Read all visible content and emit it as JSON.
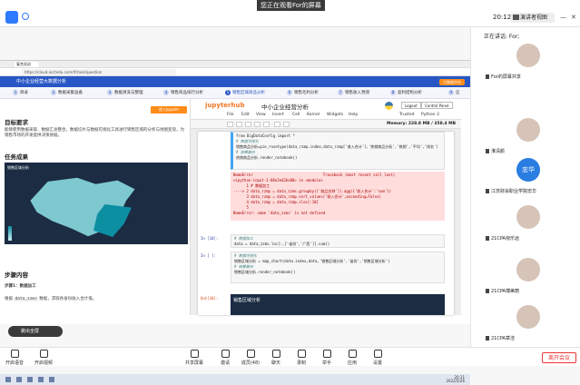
{
  "meeting": {
    "banner": "您正在观看For的屏幕",
    "time": "20:12",
    "speaker_view": "演讲者视图"
  },
  "browser": {
    "tab_label": "复合实训",
    "url": "https://cloud.acctedu.com/#/task/question"
  },
  "course": {
    "title": "中小企业经营大数据分析",
    "cta": "大数据中台"
  },
  "steps": [
    {
      "n": "1",
      "label": "目录"
    },
    {
      "n": "2",
      "label": "数据采集准备"
    },
    {
      "n": "3",
      "label": "数据清洗与整理"
    },
    {
      "n": "4",
      "label": "销售商品排行分析"
    },
    {
      "n": "5",
      "label": "销售区域商品分析"
    },
    {
      "n": "6",
      "label": "销售毛利分析"
    },
    {
      "n": "7",
      "label": "销售收入预测"
    },
    {
      "n": "8",
      "label": "盈利结构分析"
    },
    {
      "n": "9",
      "label": "应"
    }
  ],
  "left": {
    "jupyter_btn": "进入Jupyter",
    "goal_title": "目标要求",
    "goal_text": "能够使用数据采取、数据汇总整合，数据切片与数据可视化工具进行销售区域的分析与地图变现，为销售市场的开发提供决策依据。",
    "result_title": "任务成果",
    "map_title": "销售区域分析",
    "steps_title": "步骤内容",
    "step1": "步骤1：数据加工",
    "step1_text": "根据",
    "step1_code": "data_zzms",
    "step1_text2": "数据，求取各省份收入合计值。",
    "back": "跳出全屏"
  },
  "jupyter": {
    "logo": "jupyterhub",
    "title": "中小企业经营分析",
    "logout": "Logout",
    "control_panel": "Control Panel",
    "menus": [
      "File",
      "Edit",
      "View",
      "Insert",
      "Cell",
      "Kernel",
      "Widgets",
      "Help"
    ],
    "trusted": "Trusted",
    "kernel": "Python 3",
    "memory": "Memory: 228.8 MB / 358.4 MB",
    "cell1": [
      "from BigDataConfig import *",
      "",
      "# 数据可视化",
      "销售商品分析=pie_rosetype(data_rzmp.index,data_rzmp['收入合计'],'热销商品分析','热销','平均','排名')",
      "",
      "# 结果展示",
      "热销商品分析.render_notebook()"
    ],
    "error": [
      "NameError                                Traceback (most recent call last)",
      "<ipython-input-1-88e3ed2be88> in <module>",
      "      1 # 数据加工",
      "----> 2 data_rzmp = data_zzms.groupby(['商品名称']).agg({'收入合计':'sum'})",
      "      3 data_rzmp = data_rzmp.sort_values('收入合计',ascending=False)",
      "      4 data_rzmp = data_rzmp.iloc[:10]",
      "      5",
      "",
      "NameError: name 'data_zzms' is not defined"
    ],
    "prompt2": "In [10]:",
    "cell2": [
      "# 数据加工",
      "data = data_zzms.loc[:,['省份','广西']].sum()"
    ],
    "prompt3": "In [ ]:",
    "cell3": [
      "# 数据可视化",
      "销售区域分析 = map_chart(data.index,data,'销售区域分析','省份','销售区域分析')",
      "",
      "# 结果展示",
      "销售区域分析.render_notebook()"
    ],
    "prompt4": "Out[10]:",
    "chart_title": "销售区域分析"
  },
  "taskbar": {
    "time": "20:11",
    "date": "2022/5/26"
  },
  "sidebar": {
    "title": "正在讲话: For;",
    "participants": [
      "For的屏幕共享",
      "淮清颜",
      "江苏财会职业学院忠华",
      "21CPA倪乐远",
      "21CPA傅美丽",
      "21CPA章洁"
    ],
    "avatar_text": "忠华"
  },
  "toolbar": [
    "开启语音",
    "开启视频",
    "共享屏幕",
    "邀请",
    "成员(48)",
    "聊天",
    "录制",
    "举手",
    "应用",
    "设置"
  ],
  "leave": "离开会议"
}
